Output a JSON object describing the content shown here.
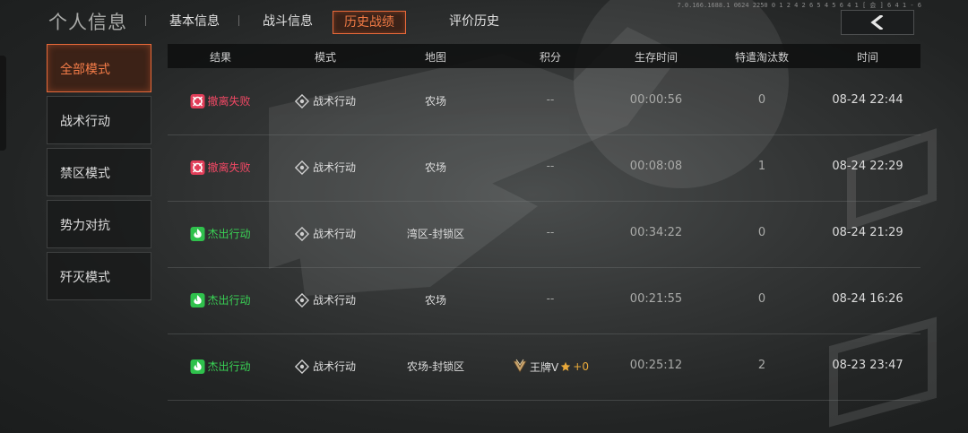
{
  "header": {
    "title": "个人信息",
    "tabs": [
      {
        "label": "基本信息",
        "active": false
      },
      {
        "label": "战斗信息",
        "active": false
      },
      {
        "label": "历史战绩",
        "active": true
      },
      {
        "label": "评价历史",
        "active": false
      }
    ],
    "version_text": "7.0.166.1688.1 0624 2250 0 1 2 4 2 6 5 4 5 6 4 1 [ 会 ] 6 4 1 - 6",
    "back_icon": "back-arrow-icon"
  },
  "sidebar": {
    "items": [
      {
        "label": "全部模式",
        "active": true
      },
      {
        "label": "战术行动",
        "active": false
      },
      {
        "label": "禁区模式",
        "active": false
      },
      {
        "label": "势力对抗",
        "active": false
      },
      {
        "label": "歼灭模式",
        "active": false
      }
    ]
  },
  "table": {
    "columns": [
      "结果",
      "模式",
      "地图",
      "积分",
      "生存时间",
      "特遣淘汰数",
      "时间"
    ],
    "rows": [
      {
        "result": "撤离失败",
        "result_type": "fail",
        "mode": "战术行动",
        "map": "农场",
        "score": "--",
        "survival": "00:00:56",
        "kills": "0",
        "time": "08-24 22:44"
      },
      {
        "result": "撤离失败",
        "result_type": "fail",
        "mode": "战术行动",
        "map": "农场",
        "score": "--",
        "survival": "00:08:08",
        "kills": "1",
        "time": "08-24 22:29"
      },
      {
        "result": "杰出行动",
        "result_type": "win",
        "mode": "战术行动",
        "map": "湾区-封锁区",
        "score": "--",
        "survival": "00:34:22",
        "kills": "0",
        "time": "08-24 21:29"
      },
      {
        "result": "杰出行动",
        "result_type": "win",
        "mode": "战术行动",
        "map": "农场",
        "score": "--",
        "survival": "00:21:55",
        "kills": "0",
        "time": "08-24 16:26"
      },
      {
        "result": "杰出行动",
        "result_type": "win",
        "mode": "战术行动",
        "map": "农场-封锁区",
        "score": "王牌V",
        "score_delta": "+0",
        "survival": "00:25:12",
        "kills": "2",
        "time": "08-23 23:47"
      }
    ]
  },
  "colors": {
    "accent": "#e8693a",
    "fail": "#f04864",
    "success": "#39d054",
    "rank_gold": "#e9a93a"
  }
}
